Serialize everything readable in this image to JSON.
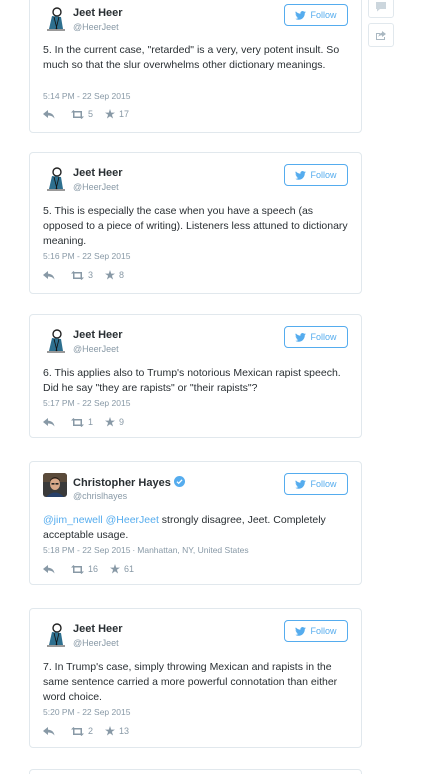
{
  "follow_label": "Follow",
  "tweets": [
    {
      "name": "Jeet Heer",
      "handle": "@HeerJeet",
      "text": "5. In the current case, \"retarded\" is a very, very potent insult. So much so that the slur overwhelms other dictionary meanings.",
      "timestamp": "5:14 PM - 22 Sep 2015",
      "retweets": "5",
      "favorites": "17"
    },
    {
      "name": "Jeet Heer",
      "handle": "@HeerJeet",
      "text": "5. This is especially the case when you have a speech (as opposed to a piece of writing). Listeners less attuned to dictionary meaning.",
      "timestamp": "5:16 PM - 22 Sep 2015",
      "retweets": "3",
      "favorites": "8"
    },
    {
      "name": "Jeet Heer",
      "handle": "@HeerJeet",
      "text": "6. This applies also to Trump's notorious Mexican rapist speech. Did he say \"they are rapists\" or \"their rapists\"?",
      "timestamp": "5:17 PM - 22 Sep 2015",
      "retweets": "1",
      "favorites": "9"
    },
    {
      "name": "Christopher Hayes",
      "handle": "@chrislhayes",
      "mention1": "@jim_newell",
      "mention2": "@HeerJeet",
      "text": " strongly disagree, Jeet. Completely acceptable usage.",
      "timestamp": "5:18 PM - 22 Sep 2015",
      "location": "Manhattan, NY, United States",
      "retweets": "16",
      "favorites": "61"
    },
    {
      "name": "Jeet Heer",
      "handle": "@HeerJeet",
      "text": "7. In Trump's case, simply throwing Mexican and rapists in the same sentence carried a more powerful connotation than either word choice.",
      "timestamp": "5:20 PM - 22 Sep 2015",
      "retweets": "2",
      "favorites": "13"
    }
  ],
  "colors": {
    "accent": "#55acee",
    "muted": "#8899a6",
    "text": "#292f33",
    "border": "#e1e8ed",
    "retweet_icon": "#8899a6"
  },
  "icons": [
    "avatar-drawing",
    "twitter-bird-icon",
    "verified-badge-icon",
    "reply-icon",
    "retweet-icon",
    "favorite-star-icon",
    "comment-icon",
    "share-icon"
  ]
}
